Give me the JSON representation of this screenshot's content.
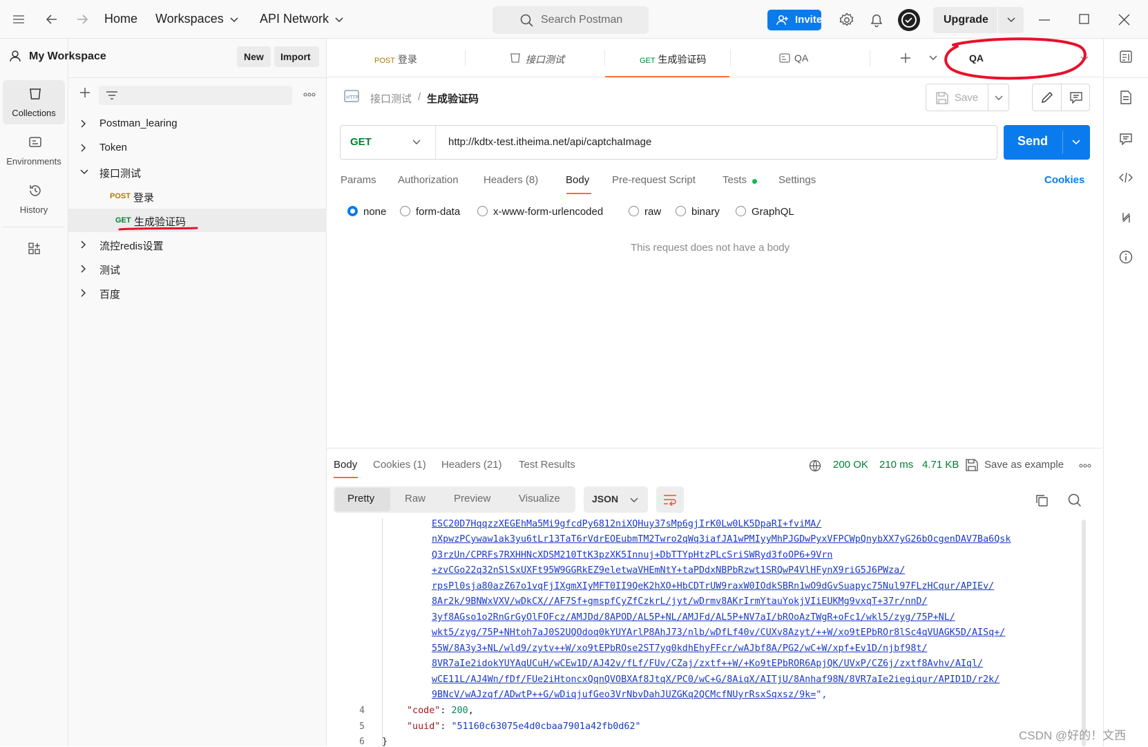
{
  "topbar": {
    "home": "Home",
    "workspaces": "Workspaces",
    "api_network": "API Network",
    "search_placeholder": "Search Postman",
    "invite": "Invite",
    "upgrade": "Upgrade"
  },
  "leftnav": {
    "items": [
      {
        "label": "Collections",
        "icon": "collections-icon"
      },
      {
        "label": "Environments",
        "icon": "environments-icon"
      },
      {
        "label": "History",
        "icon": "history-icon"
      },
      {
        "label": "",
        "icon": "apps-grid-icon"
      }
    ]
  },
  "sidebar": {
    "workspace_name": "My Workspace",
    "new_label": "New",
    "import_label": "Import",
    "tree": [
      {
        "label": "Postman_learing",
        "type": "folder",
        "expanded": false
      },
      {
        "label": "Token",
        "type": "folder",
        "expanded": false
      },
      {
        "label": "接口测试",
        "type": "folder",
        "expanded": true
      },
      {
        "method": "POST",
        "label": "登录",
        "type": "request"
      },
      {
        "method": "GET",
        "label": "生成验证码",
        "type": "request",
        "selected": true
      },
      {
        "label": "流控redis设置",
        "type": "folder",
        "expanded": false
      },
      {
        "label": "测试",
        "type": "folder",
        "expanded": false
      },
      {
        "label": "百度",
        "type": "folder",
        "expanded": false
      }
    ]
  },
  "tabs": [
    {
      "method": "POST",
      "label": "登录"
    },
    {
      "method": "",
      "label": "接口测试"
    },
    {
      "method": "GET",
      "label": "生成验证码",
      "active": true
    },
    {
      "method": "",
      "label": "QA"
    }
  ],
  "environment": "QA",
  "request": {
    "breadcrumb_parent": "接口测试",
    "breadcrumb_sep": "/",
    "breadcrumb_current": "生成验证码",
    "save_label": "Save",
    "method": "GET",
    "url": "http://kdtx-test.itheima.net/api/captchaImage",
    "send_label": "Send",
    "tabs": [
      "Params",
      "Authorization",
      "Headers (8)",
      "Body",
      "Pre-request Script",
      "Tests",
      "Settings"
    ],
    "active_tab": "Body",
    "cookies_label": "Cookies",
    "body_options": [
      "none",
      "form-data",
      "x-www-form-urlencoded",
      "raw",
      "binary",
      "GraphQL"
    ],
    "body_selected": "none",
    "no_body_message": "This request does not have a body"
  },
  "response": {
    "tabs": [
      "Body",
      "Cookies (1)",
      "Headers (21)",
      "Test Results"
    ],
    "active_tab": "Body",
    "status": "200 OK",
    "time": "210 ms",
    "size": "4.71 KB",
    "save_example": "Save as example",
    "formats": [
      "Pretty",
      "Raw",
      "Preview",
      "Visualize"
    ],
    "active_format": "Pretty",
    "language": "JSON",
    "img_lines": [
      "ESC20D7HqqzzXEGEhMa5Mi9gfcdPy6812niXQHuy37sMp6gjIrK0Lw0LK5DpaRI+fviMA/",
      "nXpwzPCywaw1ak3yu6tLr13TaT6rVdrEOEubmTM2Twro2qWq3iafJA1wPMIyyMhPJGDwPyxVFPCWpQnybXX7yG26bOcgenDAV7Ba6Qsk",
      "Q3rzUn/CPRFs7RXHHNcXDSM210TtK3pzXK5Innuj+DbTTYpHtzPLcSriSWRyd3foOP6+9Vrn",
      "+zvCGo22q32nSlSxUXFt95W9GGRkEZ9eletwaVHEmNtY+taPDdxNBPbRzwt1SRQwP4VlHFynX9riG5J6PWza/",
      "rpsPl0sja80azZ67o1vqFjIXgmXIyMFT0II9QeK2hXO+HbCDTrUW9raxW0IOdkSBRn1wO9dGvSuapyc75Nul97FLzHCqur/APIEv/",
      "8Ar2k/9BNWxVXV/wDkCX//AF7Sf+gmspfCyZfCzkrL/jyt/wDrmv8AKrIrmYtauYokjVIiEUKMg9vxqT+37r/nnD/",
      "3yf8AGso1o2RnGrGyOlFOFcz/AMJDd/8APOD/AL5P+NL/AMJFd/AL5P+NV7aI/bROoAzTWgR+oFc1/wkl5/zyg/75P+NL/",
      "wkt5/zyg/75P+NHtoh7aJ0S2UQOdoq0kYUYArlP8AhJ73/nlb/wDfLf40v/CUXv8Azyt/++W/xo9tEPbROr8lSc4qVUAGK5D/AISq+/",
      "55W/8A3y3+NL/wld9/zytv++W/xo9tEPbROse2ST7yg0kdhEhyFFcr/wAJbf8A/PG2/wC+W/xpf+Ev1D/njbf98t/",
      "8VR7aIe2idokYUYAqUCuH/wCEw1D/AJ42v/fLf/FUv/CZaj/zxtf++W/+Ko9tEPbROR6ApjQK/UVxP/CZ6j/zxtf8Avhv/AIql/",
      "wCE11L/AJ4Wn/fDf/FUe2iHtoncxQqnQVOBXAf8JtqX/PC0/wC+G/8AiqX/AITjU/8Anhaf98N/8VR7aIe2iegiqur/APID1D/r2k/",
      "9BNcV/wAJzqf/ADwtP++G/wDiqjufGeo3VrNbvDahJUZGKq2QCMcfNUyrRsxSqxsz/9k="
    ],
    "code_key": "\"code\"",
    "code_value": "200",
    "uuid_key": "\"uuid\"",
    "uuid_value": "\"51160c63075e4d0cbaa7901a42fb0d62\"",
    "line_numbers": [
      "4",
      "5",
      "6"
    ]
  },
  "watermark": "CSDN @好的！文西",
  "annotation_color": "#e8102a",
  "accent_color": "#097bed",
  "active_tab_color": "#ff6c37"
}
